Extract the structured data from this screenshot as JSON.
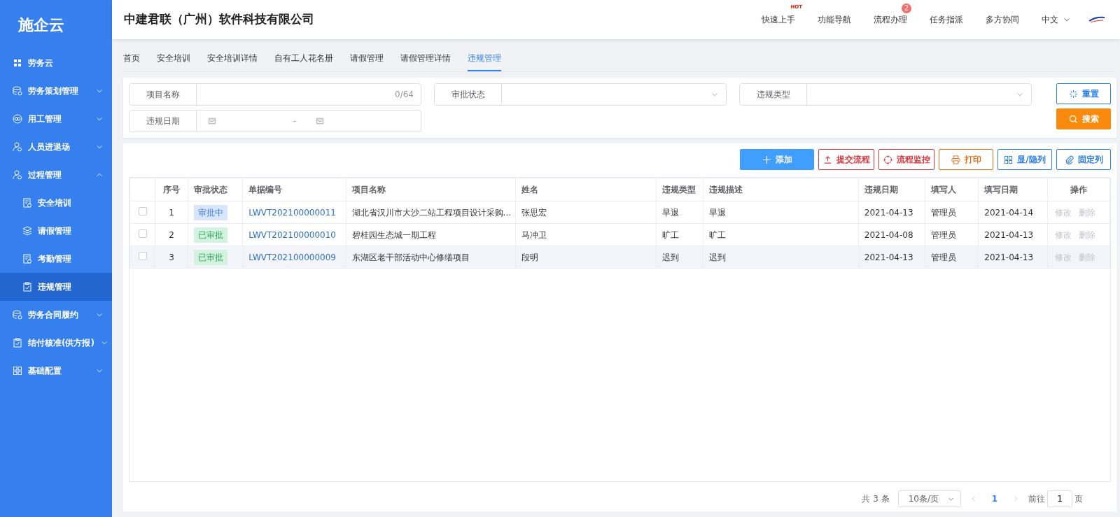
{
  "sidebar": {
    "logo": "施企云",
    "items": [
      {
        "kind": "header",
        "label": "劳务云"
      },
      {
        "kind": "group",
        "label": "劳务策划管理",
        "expanded": false
      },
      {
        "kind": "group",
        "label": "用工管理",
        "expanded": false
      },
      {
        "kind": "group",
        "label": "人员进退场",
        "expanded": false
      },
      {
        "kind": "group",
        "label": "过程管理",
        "expanded": true,
        "children": [
          {
            "label": "安全培训",
            "selected": false
          },
          {
            "label": "请假管理",
            "selected": false
          },
          {
            "label": "考勤管理",
            "selected": false
          },
          {
            "label": "违规管理",
            "selected": true
          }
        ]
      },
      {
        "kind": "group",
        "label": "劳务合同履约",
        "expanded": false
      },
      {
        "kind": "group",
        "label": "结付核准(供方报)",
        "expanded": false
      },
      {
        "kind": "group",
        "label": "基础配置",
        "expanded": false
      }
    ]
  },
  "header": {
    "company": "中建君联（广州）软件科技有限公司",
    "nav": [
      {
        "label": "快速上手",
        "hot": "HOT"
      },
      {
        "label": "功能导航"
      },
      {
        "label": "流程办理",
        "badge": "2"
      },
      {
        "label": "任务指派"
      },
      {
        "label": "多方协同"
      }
    ],
    "language": "中文"
  },
  "tabs": [
    {
      "label": "首页",
      "selected": false
    },
    {
      "label": "安全培训",
      "selected": false
    },
    {
      "label": "安全培训详情",
      "selected": false
    },
    {
      "label": "自有工人花名册",
      "selected": false
    },
    {
      "label": "请假管理",
      "selected": false
    },
    {
      "label": "请假管理详情",
      "selected": false
    },
    {
      "label": "违规管理",
      "selected": true
    }
  ],
  "filters": [
    {
      "kind": "text",
      "label": "项目名称",
      "counter": "0/64"
    },
    {
      "kind": "select",
      "label": "审批状态"
    },
    {
      "kind": "select",
      "label": "违规类型"
    },
    {
      "kind": "daterange",
      "label": "违规日期",
      "separator": "-"
    }
  ],
  "filter_buttons": {
    "reset": "重置",
    "search": "搜索"
  },
  "toolbar": [
    {
      "kind": "primary",
      "label": "添加"
    },
    {
      "kind": "danger",
      "label": "提交流程"
    },
    {
      "kind": "danger",
      "label": "流程监控"
    },
    {
      "kind": "warning",
      "label": "打印"
    },
    {
      "kind": "info",
      "label": "显/隐列"
    },
    {
      "kind": "info",
      "label": "固定列"
    }
  ],
  "table": {
    "columns": [
      "序号",
      "审批状态",
      "单据编号",
      "项目名称",
      "姓名",
      "违规类型",
      "违规描述",
      "违规日期",
      "填写人",
      "填写日期",
      "操作"
    ],
    "rows": [
      {
        "checked": false,
        "highlighted": false,
        "no": "1",
        "status": {
          "kind": "pending",
          "label": "审批中"
        },
        "code": "LWVT202100000011",
        "project": "湖北省汉川市大沙二站工程项目设计采购...",
        "name": "张思宏",
        "type": "早退",
        "desc": "早退",
        "date": "2021-04-13",
        "writer": "管理员",
        "write_date": "2021-04-14",
        "actions": [
          {
            "label": "修改",
            "disabled": true
          },
          {
            "label": "删除",
            "disabled": true
          }
        ]
      },
      {
        "checked": false,
        "highlighted": false,
        "no": "2",
        "status": {
          "kind": "approved",
          "label": "已审批"
        },
        "code": "LWVT202100000010",
        "project": "碧桂园生态城一期工程",
        "name": "马冲卫",
        "type": "旷工",
        "desc": "旷工",
        "date": "2021-04-08",
        "writer": "管理员",
        "write_date": "2021-04-13",
        "actions": [
          {
            "label": "修改",
            "disabled": true
          },
          {
            "label": "删除",
            "disabled": true
          }
        ]
      },
      {
        "checked": false,
        "highlighted": true,
        "no": "3",
        "status": {
          "kind": "approved",
          "label": "已审批"
        },
        "code": "LWVT202100000009",
        "project": "东湖区老干部活动中心修缮项目",
        "name": "段明",
        "type": "迟到",
        "desc": "迟到",
        "date": "2021-04-13",
        "writer": "管理员",
        "write_date": "2021-04-13",
        "actions": [
          {
            "label": "修改",
            "disabled": true
          },
          {
            "label": "删除",
            "disabled": true
          }
        ]
      }
    ]
  },
  "pagination": {
    "total": "共 3 条",
    "page_size": "10条/页",
    "current": "1",
    "goto_label": "前往",
    "goto_value": "1",
    "page_suffix": "页"
  }
}
